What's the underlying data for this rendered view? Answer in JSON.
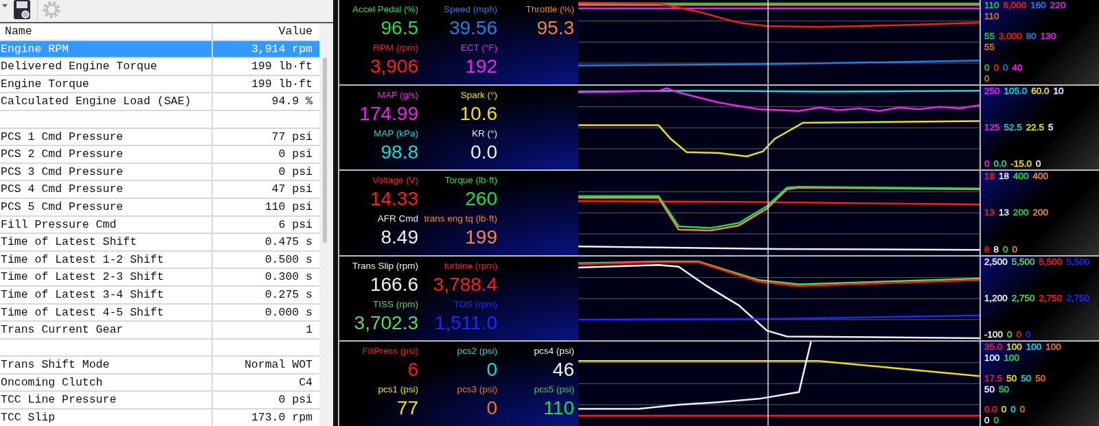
{
  "toolbar": {
    "items": [
      {
        "kind": "dropdown",
        "disabled": false
      },
      {
        "kind": "scanner",
        "disabled": false
      },
      {
        "kind": "gear",
        "disabled": true
      }
    ]
  },
  "table": {
    "columns": [
      "Name",
      "Value"
    ],
    "rows": [
      {
        "kind": "data",
        "name": "Engine RPM",
        "value": "3,914 rpm",
        "selected": true
      },
      {
        "kind": "data",
        "name": "Delivered Engine Torque",
        "value": "199 lb·ft",
        "selected": false
      },
      {
        "kind": "data",
        "name": "Engine Torque",
        "value": "199 lb·ft",
        "selected": false
      },
      {
        "kind": "data",
        "name": "Calculated Engine Load (SAE)",
        "value": "94.9 %",
        "selected": false
      },
      {
        "kind": "blank",
        "selected": false
      },
      {
        "kind": "data",
        "name": "PCS 1 Cmd Pressure",
        "value": "77 psi",
        "selected": false
      },
      {
        "kind": "data",
        "name": "PCS 2 Cmd Pressure",
        "value": "0 psi",
        "selected": false
      },
      {
        "kind": "data",
        "name": "PCS 3 Cmd Pressure",
        "value": "0 psi",
        "selected": false
      },
      {
        "kind": "data",
        "name": "PCS 4 Cmd Pressure",
        "value": "47 psi",
        "selected": false
      },
      {
        "kind": "data",
        "name": "PCS 5 Cmd Pressure",
        "value": "110 psi",
        "selected": false
      },
      {
        "kind": "data",
        "name": "Fill Pressure Cmd",
        "value": "6 psi",
        "selected": false
      },
      {
        "kind": "data",
        "name": "Time of Latest Shift",
        "value": "0.475 s",
        "selected": false
      },
      {
        "kind": "data",
        "name": "Time of Latest 1-2 Shift",
        "value": "0.500 s",
        "selected": false
      },
      {
        "kind": "data",
        "name": "Time of Latest 2-3 Shift",
        "value": "0.300 s",
        "selected": false
      },
      {
        "kind": "data",
        "name": "Time of Latest 3-4 Shift",
        "value": "0.275 s",
        "selected": false
      },
      {
        "kind": "data",
        "name": "Time of Latest 4-5 Shift",
        "value": "0.000 s",
        "selected": false
      },
      {
        "kind": "data",
        "name": "Trans Current Gear",
        "value": "1",
        "selected": false
      },
      {
        "kind": "blank",
        "selected": false
      },
      {
        "kind": "data",
        "name": "Trans Shift Mode",
        "value": "Normal WOT",
        "selected": false
      },
      {
        "kind": "data",
        "name": "Oncoming Clutch",
        "value": "C4",
        "selected": false
      },
      {
        "kind": "data",
        "name": "TCC Line Pressure",
        "value": "0 psi",
        "selected": false
      },
      {
        "kind": "data",
        "name": "TCC Slip",
        "value": "173.0 rpm",
        "selected": false
      }
    ]
  },
  "panels": [
    {
      "gauges": [
        {
          "label": "Accel Pedal (%)",
          "value": "96.5",
          "color": "#22dd44"
        },
        {
          "label": "Speed (mph)",
          "value": "39.56",
          "color": "#1e7fe8"
        },
        {
          "label": "Throttle (%)",
          "value": "95.3",
          "color": "#f08a1c"
        },
        {
          "label": "RPM (rpm)",
          "value": "3,906",
          "color": "#ff1a1a"
        },
        {
          "label": "ECT (°F)",
          "value": "192",
          "color": "#ee22ee"
        }
      ],
      "scale": [
        {
          "lines": [
            {
              "items": [
                {
                  "text": "110",
                  "color": "#22cc44"
                },
                {
                  "text": "6,000",
                  "color": "#ff1a1a"
                },
                {
                  "text": "160",
                  "color": "#1e7fe8"
                },
                {
                  "text": "220",
                  "color": "#ee22ee"
                }
              ]
            },
            {
              "items": [
                {
                  "text": "110",
                  "color": "#e07a1c"
                }
              ]
            }
          ]
        },
        {
          "lines": [
            {
              "items": [
                {
                  "text": "55",
                  "color": "#22cc44"
                },
                {
                  "text": "3,000",
                  "color": "#ff1a1a"
                },
                {
                  "text": "80",
                  "color": "#1e7fe8"
                },
                {
                  "text": "130",
                  "color": "#ee22ee"
                }
              ]
            },
            {
              "items": [
                {
                  "text": "55",
                  "color": "#e07a1c"
                }
              ]
            }
          ]
        },
        {
          "lines": [
            {
              "items": [
                {
                  "text": "0",
                  "color": "#22cc44"
                },
                {
                  "text": "0",
                  "color": "#ff1a1a"
                },
                {
                  "text": "0",
                  "color": "#1e7fe8"
                },
                {
                  "text": "40",
                  "color": "#ee22ee"
                }
              ]
            },
            {
              "items": [
                {
                  "text": "0",
                  "color": "#e07a1c"
                }
              ]
            }
          ]
        }
      ]
    },
    {
      "gauges": [
        {
          "label": "MAF (g/s)",
          "value": "174.99",
          "color": "#ee22ee"
        },
        {
          "label": "Spark (°)",
          "value": "10.6",
          "color": "#f0e010"
        },
        {
          "label": "MAP (kPa)",
          "value": "98.8",
          "color": "#19d8d8"
        },
        {
          "label": "KR (°)",
          "value": "0.0",
          "color": "#f0f0f0"
        }
      ],
      "scale": [
        {
          "lines": [
            {
              "items": [
                {
                  "text": "250",
                  "color": "#ee22ee"
                },
                {
                  "text": "105.0",
                  "color": "#19d8d8"
                },
                {
                  "text": "60.0",
                  "color": "#f0e010"
                },
                {
                  "text": "10",
                  "color": "#f0f0f0"
                }
              ]
            }
          ]
        },
        {
          "lines": [
            {
              "items": [
                {
                  "text": "125",
                  "color": "#ee22ee"
                },
                {
                  "text": "52.5",
                  "color": "#19d8d8"
                },
                {
                  "text": "22.5",
                  "color": "#f0e010"
                },
                {
                  "text": "5",
                  "color": "#f0f0f0"
                }
              ]
            }
          ]
        },
        {
          "lines": [
            {
              "items": [
                {
                  "text": "0",
                  "color": "#ee22ee"
                },
                {
                  "text": "0.0",
                  "color": "#19d8d8"
                },
                {
                  "text": "-15.0",
                  "color": "#f0e010"
                },
                {
                  "text": "0",
                  "color": "#f0f0f0"
                }
              ]
            }
          ]
        }
      ]
    },
    {
      "gauges": [
        {
          "label": "Voltage (V)",
          "value": "14.33",
          "color": "#ff1a1a"
        },
        {
          "label": "Torque (lb·ft)",
          "value": "260",
          "color": "#22dd44"
        },
        {
          "label": "AFR Cmd",
          "value": "8.49",
          "color": "#f0f0f0"
        },
        {
          "label": "trans eng tq (lb·ft)",
          "value": "199",
          "color": "#f08a4c"
        }
      ],
      "scale": [
        {
          "lines": [
            {
              "items": [
                {
                  "text": "18",
                  "color": "#ff1a1a"
                },
                {
                  "text": "18",
                  "color": "#f0f0f0"
                },
                {
                  "text": "400",
                  "color": "#22dd44"
                },
                {
                  "text": "400",
                  "color": "#f08a4c"
                }
              ]
            }
          ]
        },
        {
          "lines": [
            {
              "items": [
                {
                  "text": "13",
                  "color": "#ff1a1a"
                },
                {
                  "text": "13",
                  "color": "#f0f0f0"
                },
                {
                  "text": "200",
                  "color": "#22dd44"
                },
                {
                  "text": "200",
                  "color": "#f08a4c"
                }
              ]
            }
          ]
        },
        {
          "lines": [
            {
              "items": [
                {
                  "text": "8",
                  "color": "#ff1a1a"
                },
                {
                  "text": "8",
                  "color": "#f0f0f0"
                },
                {
                  "text": "0",
                  "color": "#22dd44"
                },
                {
                  "text": "0",
                  "color": "#f08a4c"
                }
              ]
            }
          ]
        }
      ]
    },
    {
      "gauges": [
        {
          "label": "Trans Slip (rpm)",
          "value": "166.6",
          "color": "#f0f0f0"
        },
        {
          "label": "turbine (rpm)",
          "value": "3,788.4",
          "color": "#ff1a1a"
        },
        {
          "label": "TISS (rpm)",
          "value": "3,702.3",
          "color": "#5cd85c"
        },
        {
          "label": "TOS (rpm)",
          "value": "1,511.0",
          "color": "#1a2aff"
        }
      ],
      "scale": [
        {
          "lines": [
            {
              "items": [
                {
                  "text": "2,500",
                  "color": "#f0f0f0"
                },
                {
                  "text": "5,500",
                  "color": "#5cd85c"
                },
                {
                  "text": "5,500",
                  "color": "#ff1a1a"
                },
                {
                  "text": "5,500",
                  "color": "#1a2aff"
                }
              ]
            }
          ]
        },
        {
          "lines": [
            {
              "items": [
                {
                  "text": "1,200",
                  "color": "#f0f0f0"
                },
                {
                  "text": "2,750",
                  "color": "#5cd85c"
                },
                {
                  "text": "2,750",
                  "color": "#ff1a1a"
                },
                {
                  "text": "2,750",
                  "color": "#1a2aff"
                }
              ]
            }
          ]
        },
        {
          "lines": [
            {
              "items": [
                {
                  "text": "-100",
                  "color": "#f0f0f0"
                },
                {
                  "text": "0",
                  "color": "#5cd85c"
                },
                {
                  "text": "0",
                  "color": "#ff1a1a"
                },
                {
                  "text": "0",
                  "color": "#1a2aff"
                }
              ]
            }
          ]
        }
      ]
    },
    {
      "gauges": [
        {
          "label": "FillPress (psi)",
          "value": "6",
          "color": "#ff1a1a"
        },
        {
          "label": "pcs2 (psi)",
          "value": "0",
          "color": "#19d8d8"
        },
        {
          "label": "pcs4 (psi)",
          "value": "46",
          "color": "#f0f0f0"
        },
        {
          "label": "pcs1 (psi)",
          "value": "77",
          "color": "#f0e010"
        },
        {
          "label": "pcs3 (psi)",
          "value": "0",
          "color": "#f07a10"
        },
        {
          "label": "pcs5 (psi)",
          "value": "110",
          "color": "#22dd44"
        }
      ],
      "scale": [
        {
          "lines": [
            {
              "items": [
                {
                  "text": "35.0",
                  "color": "#ff1a1a"
                },
                {
                  "text": "100",
                  "color": "#f0e010"
                },
                {
                  "text": "100",
                  "color": "#19d8d8"
                },
                {
                  "text": "100",
                  "color": "#f07a10"
                }
              ]
            },
            {
              "items": [
                {
                  "text": "100",
                  "color": "#f0f0f0"
                },
                {
                  "text": "100",
                  "color": "#22dd44"
                }
              ]
            }
          ]
        },
        {
          "lines": [
            {
              "items": [
                {
                  "text": "17.5",
                  "color": "#ff1a1a"
                },
                {
                  "text": "50",
                  "color": "#f0e010"
                },
                {
                  "text": "50",
                  "color": "#19d8d8"
                },
                {
                  "text": "50",
                  "color": "#f07a10"
                }
              ]
            },
            {
              "items": [
                {
                  "text": "50",
                  "color": "#f0f0f0"
                },
                {
                  "text": "50",
                  "color": "#22dd44"
                }
              ]
            }
          ]
        },
        {
          "lines": [
            {
              "items": [
                {
                  "text": "0.0",
                  "color": "#ff1a1a"
                },
                {
                  "text": "0",
                  "color": "#f0e010"
                },
                {
                  "text": "0",
                  "color": "#19d8d8"
                },
                {
                  "text": "0",
                  "color": "#f07a10"
                }
              ]
            },
            {
              "items": [
                {
                  "text": "0",
                  "color": "#f0f0f0"
                },
                {
                  "text": "0",
                  "color": "#22dd44"
                }
              ]
            }
          ]
        }
      ]
    }
  ]
}
